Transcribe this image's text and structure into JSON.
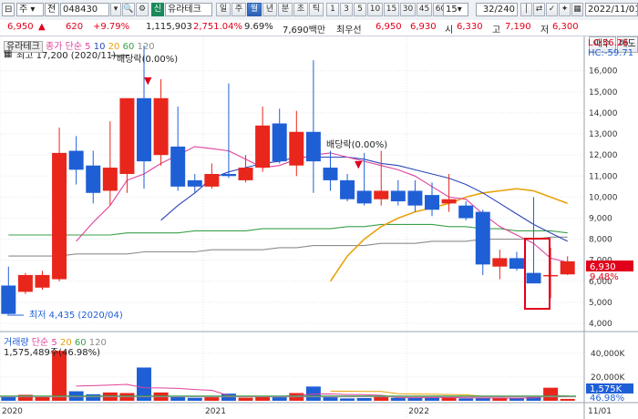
{
  "toolbar": {
    "menu1": "주",
    "menu2": "전",
    "code": "048430",
    "badge": "신",
    "stock_name": "유라테크",
    "period_buttons": [
      "일",
      "주",
      "월",
      "년",
      "분",
      "초",
      "틱"
    ],
    "active_period": "월",
    "interval_buttons": [
      "1",
      "3",
      "5",
      "10",
      "15",
      "30",
      "45",
      "60"
    ],
    "interval_value": "15",
    "page_counter": "32/240",
    "date": "2022/11/01"
  },
  "price_info": {
    "current": "6,950",
    "change": "620",
    "change_pct": "+9.79%",
    "volume": "1,115,903",
    "volume_pct": "2,751.04%",
    "turnover": "9.69%",
    "amount": "7,690백만",
    "pref_label": "최우선",
    "pref1": "6,950",
    "pref2": "6,930",
    "open_label": "시",
    "open": "6,330",
    "high_label": "고",
    "high": "7,190",
    "low_label": "저",
    "low": "6,300"
  },
  "right_buttons": {
    "buy": "매수",
    "sell": "매도"
  },
  "price_legend": {
    "name": "유라테크",
    "ma_label": "종가 단순",
    "ma_periods": [
      "5",
      "10",
      "20",
      "60",
      "120"
    ],
    "lc": "LC:56.26",
    "hc": "HC:-59.71"
  },
  "volume_legend": {
    "name": "거래량",
    "ma_label": "단순",
    "ma_periods": [
      "5",
      "20",
      "60",
      "120"
    ],
    "current": "1,575,489주(46.98%)"
  },
  "annotations": {
    "high_marker": "최고 17,200 (2020/11)",
    "low_marker": "최저 4,435 (2020/04)",
    "dividend1": "배당락(0.00%)",
    "dividend2": "배당락(0.00%)"
  },
  "price_axis": {
    "ticks": [
      "16,000",
      "15,000",
      "14,000",
      "13,000",
      "12,000",
      "11,000",
      "10,000",
      "9,000",
      "8,000",
      "7,000",
      "6,000",
      "5,000",
      "4,000"
    ],
    "current_price_tag": "6,930",
    "current_pct_tag": "9.48%"
  },
  "volume_axis": {
    "ticks": [
      "40,000K",
      "20,000K"
    ],
    "current_tag": "1,575K",
    "current_pct": "46.98%"
  },
  "date_axis": {
    "labels": [
      "2020",
      "2021",
      "2022",
      "11/01"
    ]
  },
  "colors": {
    "up": "#e8261c",
    "down": "#1f5fd6",
    "ma5": "#e0429a",
    "ma10": "#2a46b8",
    "ma20": "#e9a20a",
    "ma60": "#3aa04a",
    "ma120": "#8c8c8c"
  },
  "chart_data": {
    "type": "candlestick",
    "ylim": [
      3700,
      17200
    ],
    "candles": [
      {
        "o": 5800,
        "h": 6700,
        "l": 4435,
        "c": 4450
      },
      {
        "o": 5500,
        "h": 6400,
        "l": 5400,
        "c": 6300
      },
      {
        "o": 5700,
        "h": 6500,
        "l": 5600,
        "c": 6300
      },
      {
        "o": 6100,
        "h": 13300,
        "l": 6000,
        "c": 12100
      },
      {
        "o": 12200,
        "h": 12900,
        "l": 10600,
        "c": 11300
      },
      {
        "o": 11500,
        "h": 12200,
        "l": 9700,
        "c": 10200
      },
      {
        "o": 10300,
        "h": 13600,
        "l": 9600,
        "c": 11400
      },
      {
        "o": 11100,
        "h": 14300,
        "l": 10200,
        "c": 14700
      },
      {
        "o": 14700,
        "h": 17200,
        "l": 10400,
        "c": 11700
      },
      {
        "o": 12000,
        "h": 15600,
        "l": 11500,
        "c": 14700
      },
      {
        "o": 12400,
        "h": 14300,
        "l": 10300,
        "c": 10500
      },
      {
        "o": 10800,
        "h": 11100,
        "l": 10200,
        "c": 10500
      },
      {
        "o": 10500,
        "h": 11600,
        "l": 10400,
        "c": 11100
      },
      {
        "o": 11100,
        "h": 15400,
        "l": 10900,
        "c": 11000
      },
      {
        "o": 10800,
        "h": 12000,
        "l": 10700,
        "c": 11400
      },
      {
        "o": 11400,
        "h": 14300,
        "l": 11200,
        "c": 13400
      },
      {
        "o": 13500,
        "h": 14200,
        "l": 11600,
        "c": 11700
      },
      {
        "o": 11500,
        "h": 14100,
        "l": 11000,
        "c": 13100
      },
      {
        "o": 13100,
        "h": 16500,
        "l": 10200,
        "c": 11700
      },
      {
        "o": 11400,
        "h": 12200,
        "l": 10300,
        "c": 10800
      },
      {
        "o": 10800,
        "h": 11100,
        "l": 9800,
        "c": 9900
      },
      {
        "o": 10300,
        "h": 12100,
        "l": 9600,
        "c": 9700
      },
      {
        "o": 9900,
        "h": 12200,
        "l": 9600,
        "c": 10300
      },
      {
        "o": 10300,
        "h": 10800,
        "l": 9600,
        "c": 9800
      },
      {
        "o": 10300,
        "h": 10800,
        "l": 9300,
        "c": 9600
      },
      {
        "o": 10100,
        "h": 10700,
        "l": 9100,
        "c": 9400
      },
      {
        "o": 9700,
        "h": 11100,
        "l": 9300,
        "c": 9900
      },
      {
        "o": 9600,
        "h": 9800,
        "l": 8900,
        "c": 9000
      },
      {
        "o": 9300,
        "h": 9400,
        "l": 6300,
        "c": 6800
      },
      {
        "o": 6700,
        "h": 7500,
        "l": 6100,
        "c": 7100
      },
      {
        "o": 7100,
        "h": 7400,
        "l": 6500,
        "c": 6600
      },
      {
        "o": 6400,
        "h": 10000,
        "l": 6000,
        "c": 5900
      },
      {
        "o": 6300,
        "h": 7600,
        "l": 5200,
        "c": 6300
      },
      {
        "o": 6330,
        "h": 7190,
        "l": 6300,
        "c": 6950
      }
    ],
    "volumes_k": [
      3500,
      5000,
      3300,
      42000,
      8000,
      5500,
      7000,
      6500,
      28000,
      7000,
      3500,
      2500,
      3000,
      6000,
      2600,
      4200,
      3000,
      6500,
      12000,
      3000,
      2000,
      2300,
      3800,
      2500,
      2300,
      2600,
      2800,
      2000,
      2200,
      2200,
      2000,
      3600,
      11000,
      1575
    ],
    "ma5": [
      null,
      null,
      null,
      null,
      7900,
      8800,
      9600,
      10800,
      11100,
      11600,
      12000,
      12400,
      12300,
      12200,
      11800,
      11400,
      11500,
      11800,
      12000,
      12100,
      11900,
      11700,
      11500,
      11300,
      11000,
      10500,
      10000,
      9900,
      9200,
      8600,
      8200,
      7800,
      7100,
      6900
    ],
    "ma10": [
      null,
      null,
      null,
      null,
      null,
      null,
      null,
      null,
      null,
      8900,
      9600,
      10200,
      10900,
      11200,
      11400,
      11600,
      11700,
      11900,
      11900,
      11900,
      11900,
      11800,
      11600,
      11500,
      11300,
      11100,
      10900,
      10600,
      10200,
      9700,
      9200,
      8700,
      8300,
      7900
    ],
    "ma20": [
      null,
      null,
      null,
      null,
      null,
      null,
      null,
      null,
      null,
      null,
      null,
      null,
      null,
      null,
      null,
      null,
      null,
      null,
      null,
      6000,
      7200,
      8000,
      8600,
      9000,
      9300,
      9500,
      9700,
      10000,
      10200,
      10300,
      10400,
      10300,
      10000,
      9700
    ],
    "ma60": [
      8200,
      8200,
      8200,
      8200,
      8200,
      8200,
      8200,
      8300,
      8300,
      8300,
      8300,
      8400,
      8400,
      8400,
      8400,
      8500,
      8500,
      8500,
      8500,
      8500,
      8600,
      8600,
      8700,
      8700,
      8700,
      8700,
      8600,
      8600,
      8500,
      8500,
      8400,
      8400,
      8400,
      8300
    ],
    "ma120": [
      7200,
      7200,
      7200,
      7200,
      7300,
      7300,
      7300,
      7300,
      7400,
      7400,
      7400,
      7400,
      7500,
      7500,
      7500,
      7500,
      7600,
      7600,
      7700,
      7700,
      7700,
      7700,
      7800,
      7800,
      7800,
      7900,
      7900,
      7900,
      8000,
      8000,
      8000,
      8000,
      8100,
      8100
    ]
  }
}
